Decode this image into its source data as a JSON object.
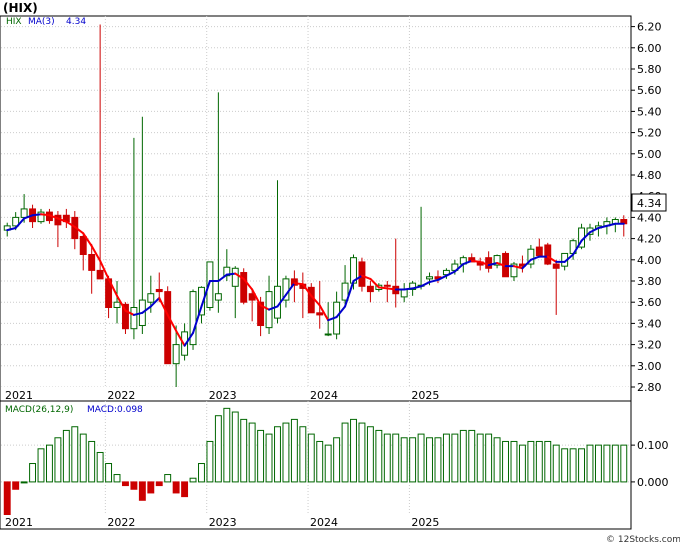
{
  "header": {
    "title": "(HIX)"
  },
  "legend": {
    "ticker": "HIX",
    "ma_label": "MA(3)",
    "ma_value": "4.34"
  },
  "macd_legend": {
    "label": "MACD(26,12,9)",
    "value_label": "MACD:0.098"
  },
  "price_badge": "4.34",
  "watermark": "© 12Stocks.com",
  "colors": {
    "up": "#006600",
    "down": "#cc0000",
    "ma_up": "#0000cc",
    "ma_down": "#ff0000",
    "grid": "#cccccc",
    "badge_bg": "#ffffff"
  },
  "chart_data": [
    {
      "type": "candlestick",
      "title": "(HIX)",
      "x_ticks": [
        "2021",
        "2022",
        "2023",
        "2024",
        "2025"
      ],
      "y_ticks": [
        "2.80",
        "3.00",
        "3.20",
        "3.40",
        "3.60",
        "3.80",
        "4.00",
        "4.20",
        "4.40",
        "4.60",
        "4.80",
        "5.00",
        "5.20",
        "5.40",
        "5.60",
        "5.80",
        "6.00",
        "6.20"
      ],
      "ylim": [
        2.8,
        6.3
      ],
      "period": "monthly",
      "ohlc": [
        [
          4.28,
          4.35,
          4.22,
          4.32
        ],
        [
          4.32,
          4.45,
          4.28,
          4.4
        ],
        [
          4.4,
          4.62,
          4.35,
          4.48
        ],
        [
          4.48,
          4.52,
          4.3,
          4.36
        ],
        [
          4.36,
          4.48,
          4.34,
          4.45
        ],
        [
          4.45,
          4.48,
          4.34,
          4.37
        ],
        [
          4.42,
          4.46,
          4.12,
          4.33
        ],
        [
          4.42,
          4.48,
          4.3,
          4.36
        ],
        [
          4.4,
          4.46,
          4.1,
          4.2
        ],
        [
          4.22,
          4.24,
          3.9,
          4.05
        ],
        [
          4.05,
          4.15,
          3.68,
          3.9
        ],
        [
          3.9,
          6.22,
          3.82,
          3.82
        ],
        [
          3.82,
          3.85,
          3.45,
          3.55
        ],
        [
          3.55,
          3.8,
          3.4,
          3.6
        ],
        [
          3.58,
          3.6,
          3.3,
          3.35
        ],
        [
          3.35,
          5.15,
          3.25,
          3.55
        ],
        [
          3.38,
          5.35,
          3.3,
          3.62
        ],
        [
          3.6,
          3.85,
          3.5,
          3.68
        ],
        [
          3.72,
          3.88,
          3.6,
          3.7
        ],
        [
          3.7,
          3.75,
          3.02,
          3.02
        ],
        [
          3.02,
          3.38,
          2.8,
          3.2
        ],
        [
          3.1,
          3.4,
          3.05,
          3.32
        ],
        [
          3.2,
          3.72,
          3.15,
          3.7
        ],
        [
          3.48,
          3.75,
          3.4,
          3.74
        ],
        [
          3.55,
          3.98,
          3.52,
          3.98
        ],
        [
          3.62,
          5.58,
          3.5,
          3.68
        ],
        [
          3.85,
          4.1,
          3.8,
          3.93
        ],
        [
          3.75,
          3.94,
          3.45,
          3.92
        ],
        [
          3.88,
          3.92,
          3.58,
          3.6
        ],
        [
          3.68,
          3.72,
          3.42,
          3.62
        ],
        [
          3.6,
          3.65,
          3.28,
          3.38
        ],
        [
          3.36,
          3.85,
          3.3,
          3.7
        ],
        [
          3.45,
          4.75,
          3.4,
          3.75
        ],
        [
          3.62,
          3.85,
          3.55,
          3.82
        ],
        [
          3.82,
          3.9,
          3.6,
          3.76
        ],
        [
          3.77,
          3.88,
          3.45,
          3.73
        ],
        [
          3.74,
          3.78,
          3.5,
          3.5
        ],
        [
          3.5,
          3.8,
          3.35,
          3.48
        ],
        [
          3.3,
          3.6,
          3.28,
          3.3
        ],
        [
          3.3,
          3.7,
          3.25,
          3.6
        ],
        [
          3.62,
          3.95,
          3.58,
          3.78
        ],
        [
          3.78,
          4.05,
          3.72,
          4.02
        ],
        [
          3.98,
          4.02,
          3.7,
          3.75
        ],
        [
          3.75,
          3.8,
          3.6,
          3.7
        ],
        [
          3.72,
          3.78,
          3.7,
          3.76
        ],
        [
          3.76,
          3.8,
          3.6,
          3.75
        ],
        [
          3.75,
          4.2,
          3.55,
          3.68
        ],
        [
          3.65,
          3.78,
          3.6,
          3.72
        ],
        [
          3.72,
          3.8,
          3.66,
          3.78
        ],
        [
          3.76,
          4.5,
          3.72,
          3.76
        ],
        [
          3.82,
          3.88,
          3.76,
          3.84
        ],
        [
          3.84,
          3.9,
          3.78,
          3.82
        ],
        [
          3.86,
          3.92,
          3.82,
          3.9
        ],
        [
          3.9,
          4.0,
          3.86,
          3.96
        ],
        [
          3.96,
          4.04,
          3.88,
          4.02
        ],
        [
          4.02,
          4.06,
          3.98,
          3.98
        ],
        [
          3.98,
          4.02,
          3.9,
          3.95
        ],
        [
          4.02,
          4.08,
          3.88,
          3.92
        ],
        [
          3.95,
          4.05,
          3.92,
          4.04
        ],
        [
          4.06,
          4.08,
          3.84,
          3.84
        ],
        [
          3.84,
          3.98,
          3.8,
          3.96
        ],
        [
          3.96,
          4.04,
          3.88,
          3.94
        ],
        [
          3.96,
          4.14,
          3.92,
          4.1
        ],
        [
          4.12,
          4.2,
          4.02,
          4.04
        ],
        [
          4.14,
          4.16,
          3.95,
          3.96
        ],
        [
          3.96,
          4.0,
          3.48,
          3.92
        ],
        [
          3.94,
          4.06,
          3.9,
          4.06
        ],
        [
          4.06,
          4.2,
          4.0,
          4.18
        ],
        [
          4.12,
          4.34,
          4.1,
          4.3
        ],
        [
          4.24,
          4.34,
          4.18,
          4.3
        ],
        [
          4.3,
          4.36,
          4.22,
          4.32
        ],
        [
          4.32,
          4.4,
          4.24,
          4.36
        ],
        [
          4.34,
          4.4,
          4.26,
          4.38
        ],
        [
          4.38,
          4.42,
          4.22,
          4.34
        ]
      ],
      "ma3": [
        4.28,
        4.3,
        4.39,
        4.42,
        4.43,
        4.42,
        4.39,
        4.36,
        4.31,
        4.25,
        4.13,
        3.99,
        3.82,
        3.66,
        3.52,
        3.48,
        3.5,
        3.56,
        3.64,
        3.48,
        3.33,
        3.19,
        3.31,
        3.56,
        3.8,
        3.8,
        3.86,
        3.87,
        3.82,
        3.72,
        3.57,
        3.53,
        3.56,
        3.67,
        3.78,
        3.77,
        3.66,
        3.57,
        3.43,
        3.46,
        3.56,
        3.8,
        3.85,
        3.82,
        3.74,
        3.73,
        3.72,
        3.72,
        3.73,
        3.75,
        3.79,
        3.81,
        3.85,
        3.89,
        3.96,
        3.99,
        3.98,
        3.95,
        3.97,
        3.94,
        3.94,
        3.92,
        4.0,
        4.03,
        4.03,
        3.98,
        3.98,
        4.05,
        4.18,
        4.26,
        4.3,
        4.32,
        4.34,
        4.34
      ]
    },
    {
      "type": "bar",
      "title": "MACD(26,12,9)",
      "y_ticks": [
        "0.000",
        "0.100"
      ],
      "ylim": [
        -0.09,
        0.22
      ],
      "x_ticks": [
        "2021",
        "2022",
        "2023",
        "2024",
        "2025"
      ],
      "values": [
        -0.09,
        -0.02,
        0.0,
        0.05,
        0.09,
        0.1,
        0.12,
        0.14,
        0.15,
        0.13,
        0.11,
        0.08,
        0.05,
        0.02,
        -0.01,
        -0.02,
        -0.05,
        -0.03,
        -0.01,
        0.02,
        -0.03,
        -0.04,
        0.01,
        0.05,
        0.11,
        0.18,
        0.2,
        0.19,
        0.17,
        0.16,
        0.14,
        0.13,
        0.15,
        0.16,
        0.17,
        0.15,
        0.13,
        0.11,
        0.1,
        0.12,
        0.16,
        0.17,
        0.16,
        0.15,
        0.14,
        0.13,
        0.13,
        0.12,
        0.12,
        0.13,
        0.12,
        0.12,
        0.13,
        0.13,
        0.14,
        0.14,
        0.13,
        0.13,
        0.12,
        0.11,
        0.11,
        0.1,
        0.11,
        0.11,
        0.11,
        0.1,
        0.09,
        0.09,
        0.09,
        0.1,
        0.1,
        0.1,
        0.1,
        0.1
      ]
    }
  ]
}
